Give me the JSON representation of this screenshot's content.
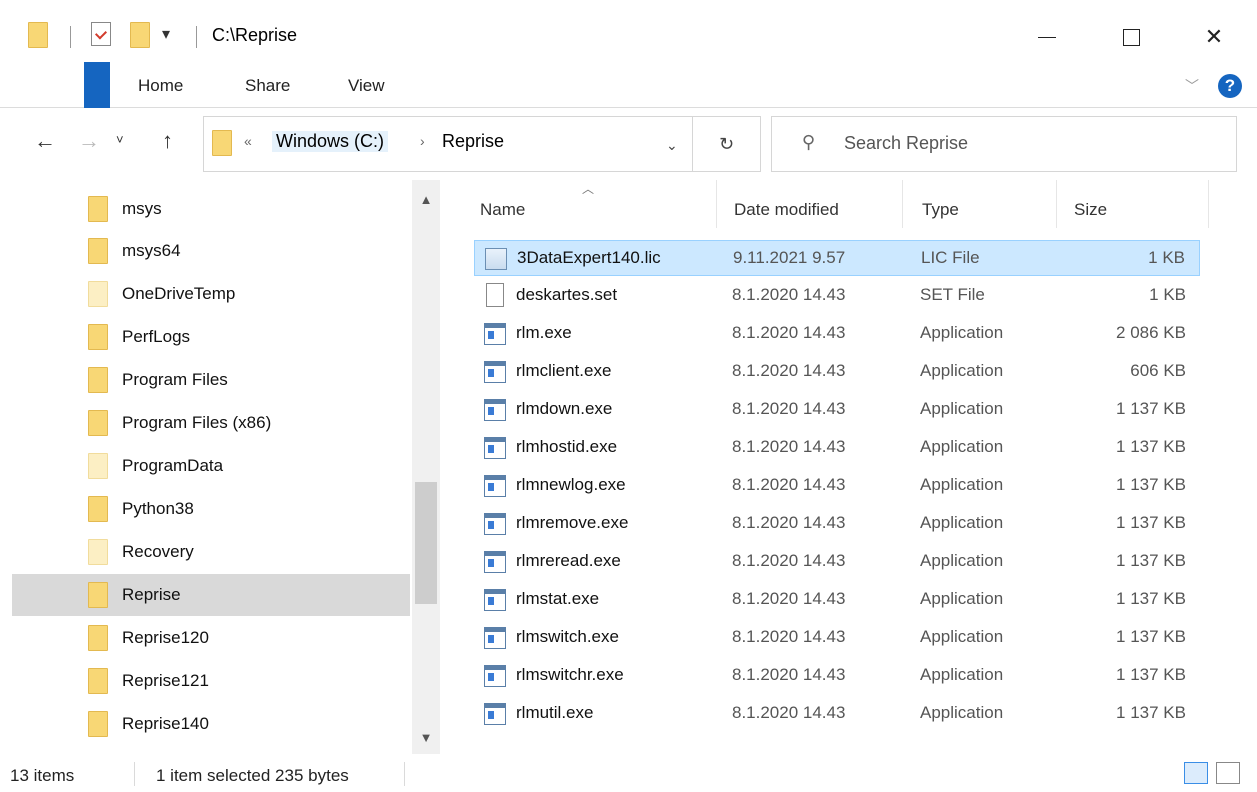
{
  "window": {
    "title": "C:\\Reprise",
    "qa_dropdown_icon": "dropdown-arrow-icon"
  },
  "ribbon": {
    "tabs": [
      "Home",
      "Share",
      "View"
    ],
    "help": "?"
  },
  "address": {
    "overflow": "«",
    "crumbs": [
      "Windows (C:)",
      "Reprise"
    ],
    "separator": "›",
    "search_placeholder": "Search Reprise"
  },
  "nav_tree": [
    {
      "label": "msys",
      "style": "normal"
    },
    {
      "label": "msys64",
      "style": "normal"
    },
    {
      "label": "OneDriveTemp",
      "style": "light"
    },
    {
      "label": "PerfLogs",
      "style": "normal"
    },
    {
      "label": "Program Files",
      "style": "normal"
    },
    {
      "label": "Program Files (x86)",
      "style": "normal"
    },
    {
      "label": "ProgramData",
      "style": "light"
    },
    {
      "label": "Python38",
      "style": "normal"
    },
    {
      "label": "Recovery",
      "style": "light"
    },
    {
      "label": "Reprise",
      "style": "selected"
    },
    {
      "label": "Reprise120",
      "style": "normal"
    },
    {
      "label": "Reprise121",
      "style": "normal"
    },
    {
      "label": "Reprise140",
      "style": "normal"
    }
  ],
  "columns": {
    "name": "Name",
    "date": "Date modified",
    "type": "Type",
    "size": "Size"
  },
  "files": [
    {
      "name": "3DataExpert140.lic",
      "date": "9.11.2021 9.57",
      "type": "LIC File",
      "size": "1 KB",
      "icon": "license-file-icon",
      "selected": true
    },
    {
      "name": "deskartes.set",
      "date": "8.1.2020 14.43",
      "type": "SET File",
      "size": "1 KB",
      "icon": "document-icon",
      "selected": false
    },
    {
      "name": "rlm.exe",
      "date": "8.1.2020 14.43",
      "type": "Application",
      "size": "2 086 KB",
      "icon": "application-icon",
      "selected": false
    },
    {
      "name": "rlmclient.exe",
      "date": "8.1.2020 14.43",
      "type": "Application",
      "size": "606 KB",
      "icon": "application-icon",
      "selected": false
    },
    {
      "name": "rlmdown.exe",
      "date": "8.1.2020 14.43",
      "type": "Application",
      "size": "1 137 KB",
      "icon": "application-icon",
      "selected": false
    },
    {
      "name": "rlmhostid.exe",
      "date": "8.1.2020 14.43",
      "type": "Application",
      "size": "1 137 KB",
      "icon": "application-icon",
      "selected": false
    },
    {
      "name": "rlmnewlog.exe",
      "date": "8.1.2020 14.43",
      "type": "Application",
      "size": "1 137 KB",
      "icon": "application-icon",
      "selected": false
    },
    {
      "name": "rlmremove.exe",
      "date": "8.1.2020 14.43",
      "type": "Application",
      "size": "1 137 KB",
      "icon": "application-icon",
      "selected": false
    },
    {
      "name": "rlmreread.exe",
      "date": "8.1.2020 14.43",
      "type": "Application",
      "size": "1 137 KB",
      "icon": "application-icon",
      "selected": false
    },
    {
      "name": "rlmstat.exe",
      "date": "8.1.2020 14.43",
      "type": "Application",
      "size": "1 137 KB",
      "icon": "application-icon",
      "selected": false
    },
    {
      "name": "rlmswitch.exe",
      "date": "8.1.2020 14.43",
      "type": "Application",
      "size": "1 137 KB",
      "icon": "application-icon",
      "selected": false
    },
    {
      "name": "rlmswitchr.exe",
      "date": "8.1.2020 14.43",
      "type": "Application",
      "size": "1 137 KB",
      "icon": "application-icon",
      "selected": false
    },
    {
      "name": "rlmutil.exe",
      "date": "8.1.2020 14.43",
      "type": "Application",
      "size": "1 137 KB",
      "icon": "application-icon",
      "selected": false
    }
  ],
  "status": {
    "item_count": "13 items",
    "selection": "1 item selected  235 bytes"
  },
  "colors": {
    "accent": "#1565c0",
    "selection_bg": "#cce8ff",
    "folder": "#f8d775"
  }
}
